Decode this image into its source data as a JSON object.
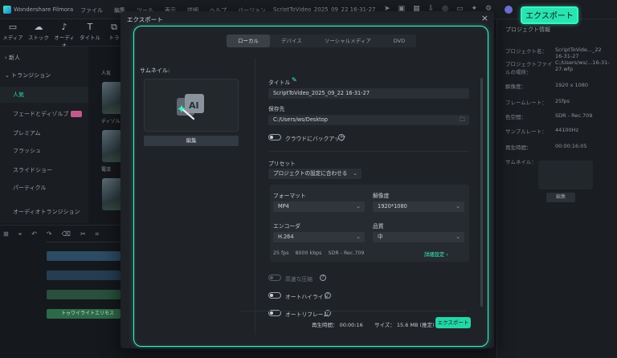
{
  "app": {
    "title": "Wondershare Filmora",
    "menus": [
      "ファイル",
      "編集",
      "ツール",
      "表示",
      "詳細",
      "ヘルプ",
      "バージョン"
    ],
    "project_title": "ScriptToVideo_2025_09_22 16-31-27",
    "export_button": "エクスポート",
    "left_tabs": [
      {
        "label": "メディア",
        "icon": "folder-icon"
      },
      {
        "label": "ストック",
        "icon": "cloud-icon"
      },
      {
        "label": "オーディオ",
        "icon": "music-note-icon"
      },
      {
        "label": "タイトル",
        "icon": "text-T-icon"
      },
      {
        "label": "トラ",
        "icon": "transition-icon"
      }
    ],
    "sidebar": {
      "items": [
        {
          "label": "新人",
          "type": "head"
        },
        {
          "label": "トランジション",
          "type": "head"
        },
        {
          "label": "人気",
          "type": "active"
        },
        {
          "label": "フェードとディゾルブ",
          "type": "item"
        },
        {
          "label": "プレミアム",
          "type": "item"
        },
        {
          "label": "フラッシュ",
          "type": "item"
        },
        {
          "label": "スライドショー",
          "type": "item"
        },
        {
          "label": "パーティクル",
          "type": "item"
        },
        {
          "label": "オーディオトランジション",
          "type": "item"
        }
      ]
    },
    "media_labels": [
      "人気",
      "ディゾル",
      "電流"
    ],
    "timeline_clip_label": "トゥワイライトエリモス"
  },
  "right_panel": {
    "title": "プロジェクト情報",
    "rows": [
      {
        "k": "プロジェクト名：",
        "v": "ScriptToVide..._22 16-31-27"
      },
      {
        "k": "プロジェクトファイルの場所：",
        "v": "C:/Users/ws/...16-31-27.wfp"
      },
      {
        "k": "解像度：",
        "v": "1920 x 1080"
      },
      {
        "k": "フレームレート：",
        "v": "25fps"
      },
      {
        "k": "色空間：",
        "v": "SDR - Rec.709"
      },
      {
        "k": "サンプルレート：",
        "v": "44100Hz"
      },
      {
        "k": "再生時間：",
        "v": "00:00:16:05"
      },
      {
        "k": "サムネイル：",
        "v": ""
      }
    ],
    "edit": "編集"
  },
  "dialog": {
    "title": "エクスポート",
    "tabs": [
      "ローカル",
      "デバイス",
      "ソーシャルメディア",
      "DVD"
    ],
    "active_tab": 0,
    "thumbnail_label": "サムネイル:",
    "thumbnail_edit": "編集",
    "title_label": "タイトル",
    "title_value": "ScriptToVideo_2025_09_22 16-31-27",
    "save_to_label": "保存先",
    "save_to_value": "C:/Users/ws/Desktop",
    "cloud_backup": "クラウドにバックアップ",
    "preset_label": "プリセット",
    "preset_value": "プロジェクトの設定に合わせる",
    "format_label": "フォーマット",
    "format_value": "MP4",
    "resolution_label": "解像度",
    "resolution_value": "1920*1080",
    "encoder_label": "エンコーダ",
    "encoder_value": "H.264",
    "quality_label": "品質",
    "quality_value": "中",
    "summary_fps": "25 fps",
    "summary_bitrate": "8000 kbps",
    "summary_color": "SDR - Rec.709",
    "advanced": "詳細設定 ›",
    "high_speed": "高速な圧縮",
    "auto_highlight": "オートハイライト",
    "auto_reframe": "オートリフレーム",
    "duration": "再生時間： 00:00:16",
    "size": "サイズ： 15.6 MB (推定)",
    "export_button": "エクスポート"
  },
  "colors": {
    "accent": "#3ff0c8",
    "export": "#24d6a6"
  }
}
